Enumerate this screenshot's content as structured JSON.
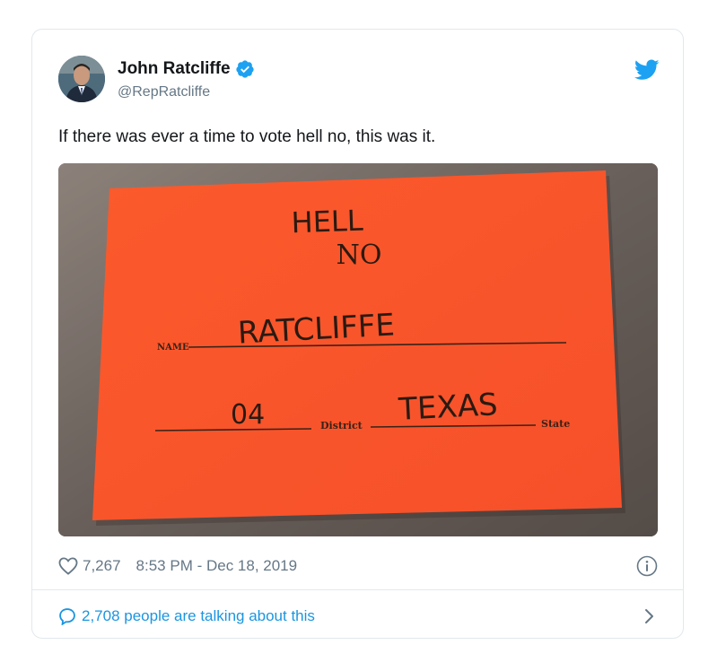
{
  "author": {
    "display_name": "John Ratcliffe",
    "handle": "@RepRatcliffe",
    "verified": true
  },
  "tweet": {
    "text": "If there was ever a time to vote hell no, this was it."
  },
  "photo": {
    "card_color": "#f9562a",
    "line1": "HELL",
    "line2": "NO",
    "name_label": "NAME",
    "name_value": "RATCLIFFE",
    "district_value": "04",
    "district_label": "District",
    "state_value": "TEXAS",
    "state_label": "State"
  },
  "stats": {
    "likes": "7,267",
    "timestamp": "8:53 PM - Dec 18, 2019"
  },
  "footer": {
    "talking": "2,708 people are talking about this"
  },
  "colors": {
    "accent": "#1da1f2",
    "link": "#1b95e0",
    "muted": "#657786",
    "border": "#e1e8ed"
  },
  "icons": [
    "verified-icon",
    "twitter-bird-icon",
    "heart-icon",
    "info-icon",
    "reply-bubble-icon",
    "chevron-right-icon"
  ]
}
